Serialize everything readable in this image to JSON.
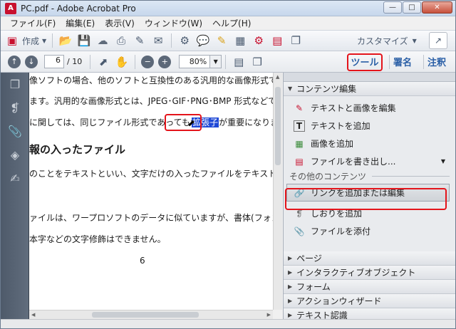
{
  "window": {
    "title": "PC.pdf - Adobe Acrobat Pro",
    "app_icon": "acrobat-icon"
  },
  "menu": [
    "ファイル(F)",
    "編集(E)",
    "表示(V)",
    "ウィンドウ(W)",
    "ヘルプ(H)"
  ],
  "toolbar": {
    "create_label": "作成",
    "customize_label": "カスタマイズ"
  },
  "nav": {
    "page_current": "6",
    "page_total": "/ 10",
    "zoom_value": "80%"
  },
  "tabs": {
    "tools": "ツール",
    "sign": "署名",
    "comment": "注釈"
  },
  "document": {
    "lines": [
      "像ソフトの場合、他のソフトと互換性のある汎用的な画像形式で保存",
      "ます。汎用的な画像形式とは、JPEG･GIF･PNG･BMP 形式などです。",
      "に関しては、同じファイル形式であっても",
      "が重要になります。",
      "報の入ったファイル",
      "のことをテキストといい、文字だけの入ったファイルをテキストファイルと",
      "ァイルは、ワープロソフトのデータに似ていますが、書体(フォント)やサ",
      "本字などの文字修飾はできません。",
      "6"
    ],
    "selected_text": "拡張子"
  },
  "panel": {
    "section_edit": "コンテンツ編集",
    "edit_items": [
      "テキストと画像を編集",
      "テキストを追加",
      "画像を追加",
      "ファイルを書き出し..."
    ],
    "other_header": "その他のコンテンツ",
    "other_items": [
      "リンクを追加または編集",
      "しおりを追加",
      "ファイルを添付"
    ],
    "collapsed_sections": [
      "ページ",
      "インタラクティブオブジェクト",
      "フォーム",
      "アクションウィザード",
      "テキスト認識"
    ]
  },
  "colors": {
    "highlight_red": "#e4141b",
    "selection_blue": "#1f49d6",
    "link_blue": "#2a5fa6"
  }
}
